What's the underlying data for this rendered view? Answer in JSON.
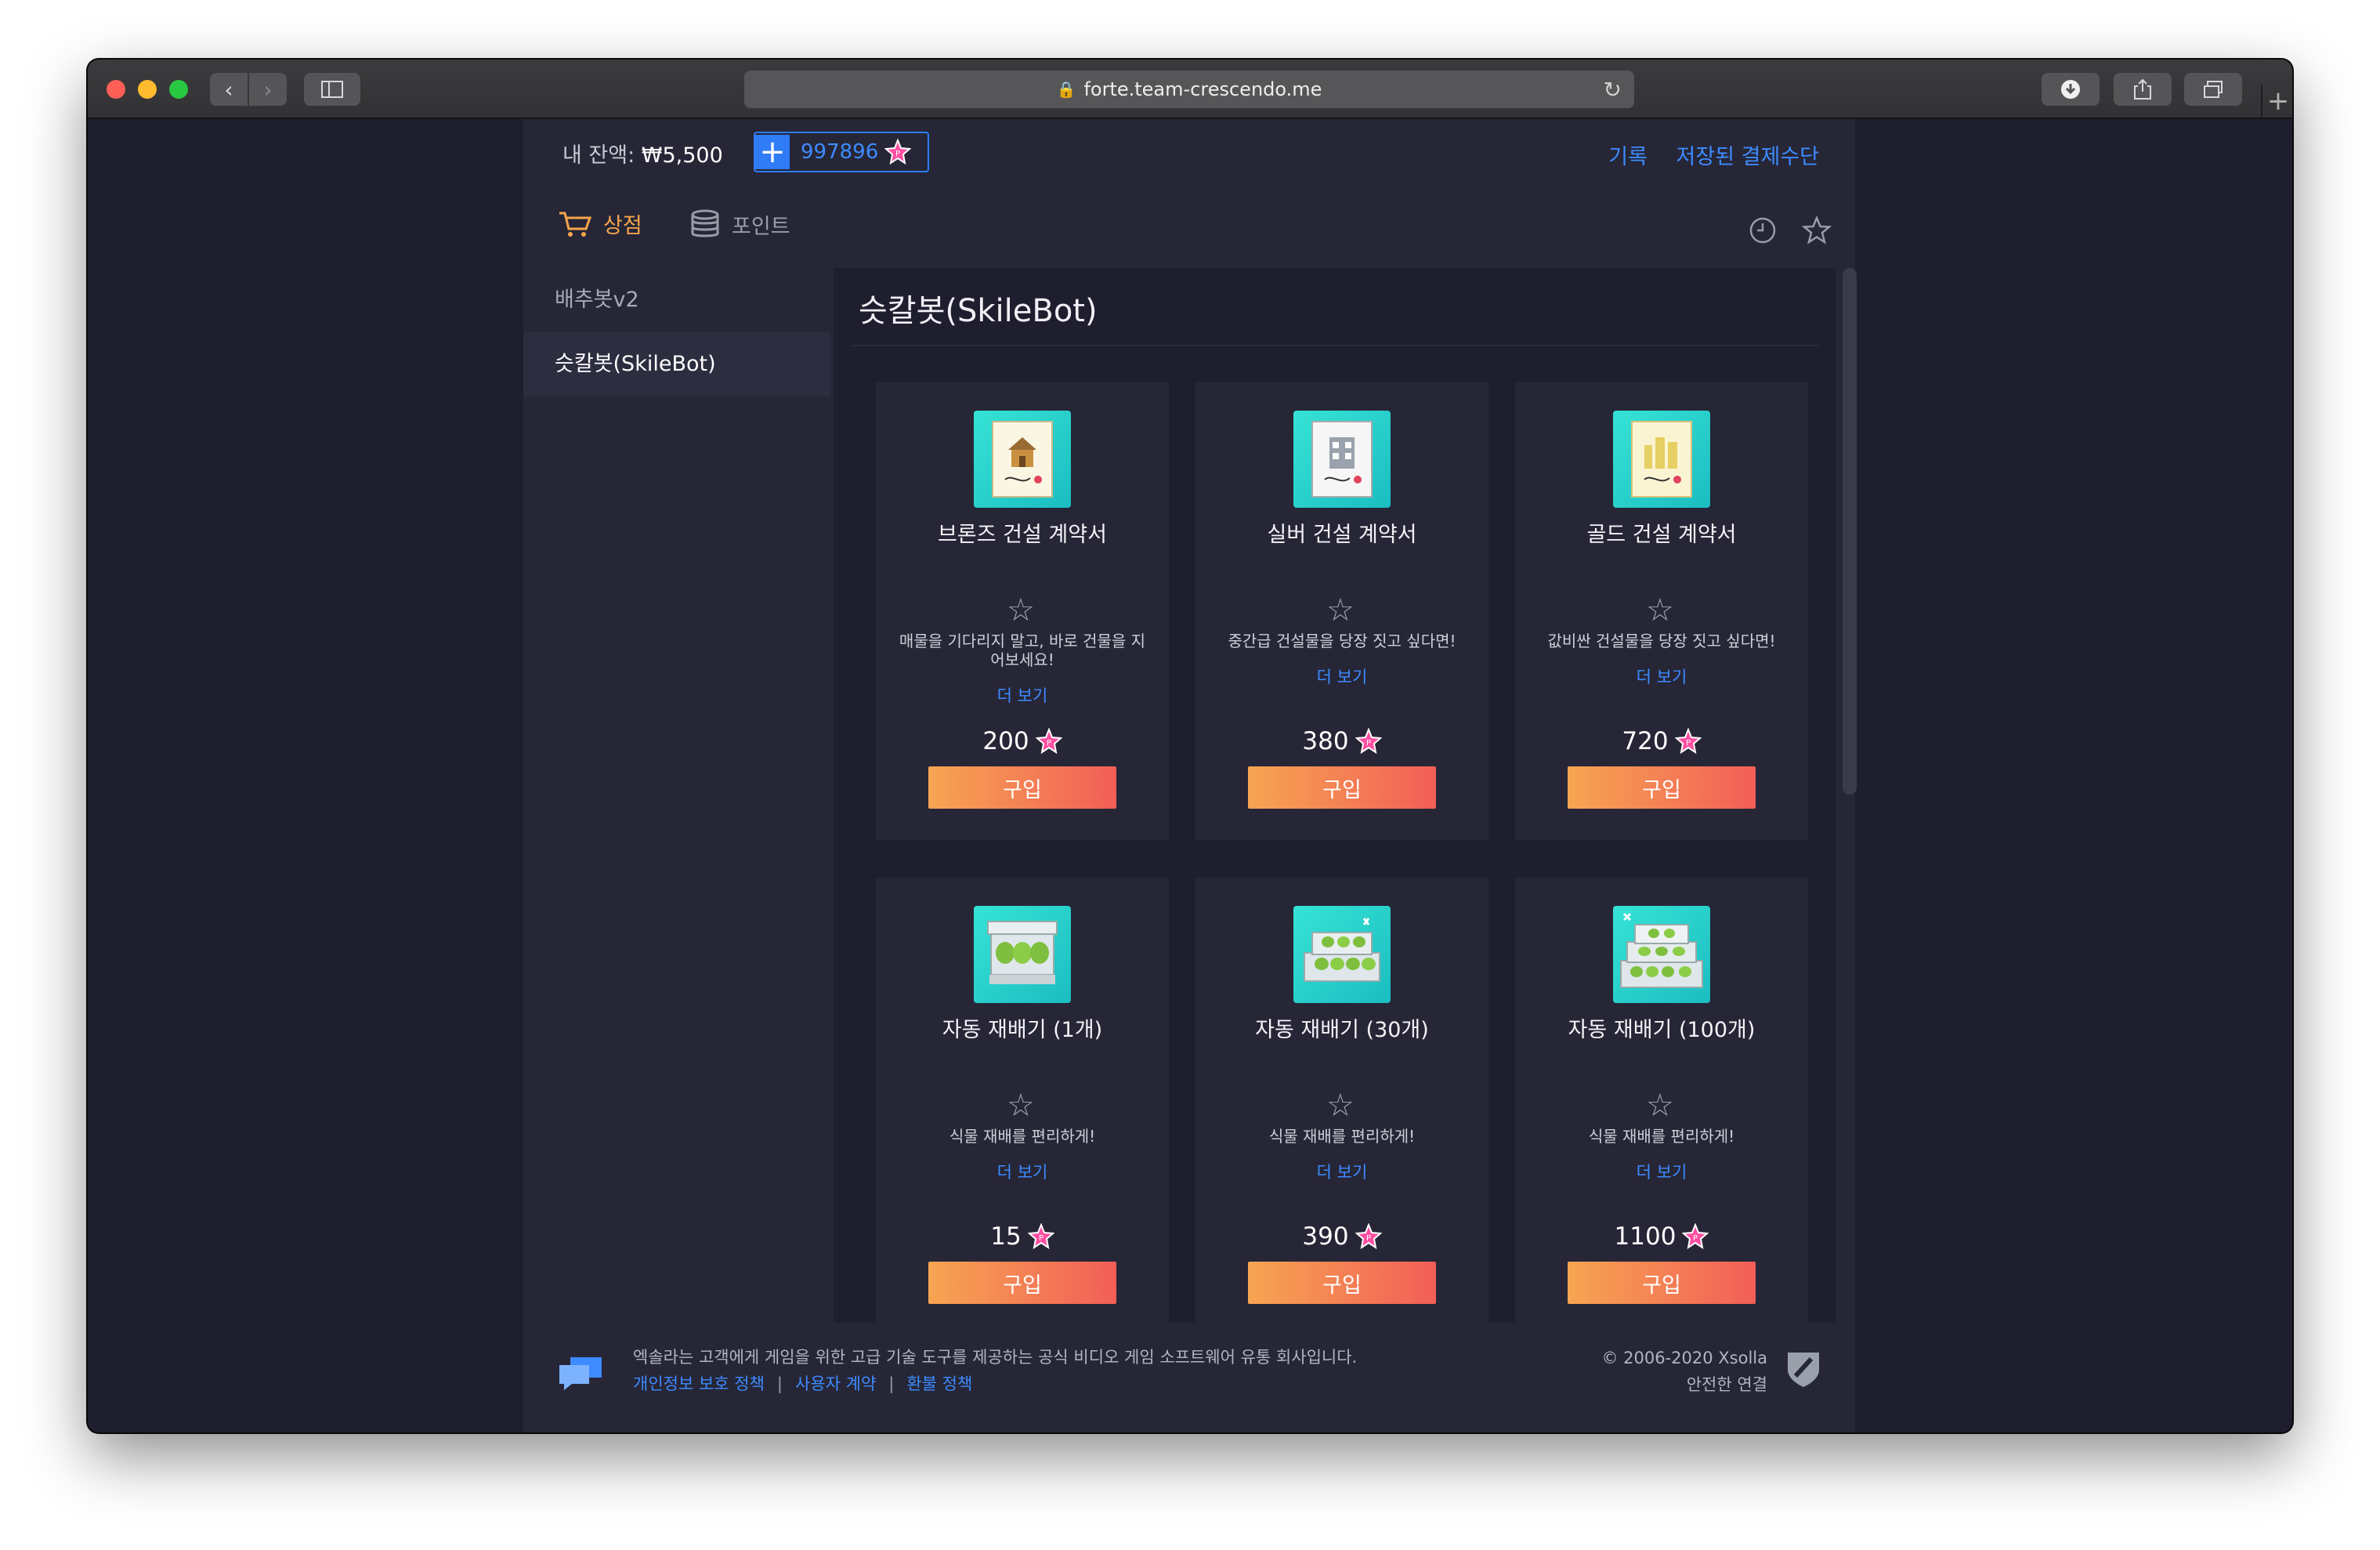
{
  "browser": {
    "url": "forte.team-crescendo.me"
  },
  "store": {
    "balance_label": "내 잔액:",
    "balance_value": "₩5,500",
    "points_value": "997896",
    "links": [
      "기록",
      "저장된 결제수단"
    ],
    "tabs": [
      {
        "label": "상점",
        "icon": "cart-icon",
        "active": true
      },
      {
        "label": "포인트",
        "icon": "coins-icon",
        "active": false
      }
    ],
    "sidebar": [
      {
        "label": "배추봇v2",
        "active": false
      },
      {
        "label": "슷칼봇(SkileBot)",
        "active": true
      }
    ],
    "section_title": "슷칼봇(SkileBot)",
    "items": [
      {
        "name": "브론즈 건설 계약서",
        "desc": "매물을 기다리지 말고, 바로 건물을 지어보세요!",
        "more": "더 보기",
        "price": "200",
        "buy": "구입",
        "icon": "contract-house-icon"
      },
      {
        "name": "실버 건설 계약서",
        "desc": "중간급 건설물을 당장 짓고 싶다면!",
        "more": "더 보기",
        "price": "380",
        "buy": "구입",
        "icon": "contract-building-icon"
      },
      {
        "name": "골드 건설 계약서",
        "desc": "값비싼 건설물을 당장 짓고 싶다면!",
        "more": "더 보기",
        "price": "720",
        "buy": "구입",
        "icon": "contract-city-icon"
      },
      {
        "name": "자동 재배기 (1개)",
        "desc": "식물 재배를 편리하게!",
        "more": "더 보기",
        "price": "15",
        "buy": "구입",
        "icon": "planter-icon"
      },
      {
        "name": "자동 재배기 (30개)",
        "desc": "식물 재배를 편리하게!",
        "more": "더 보기",
        "price": "390",
        "buy": "구입",
        "icon": "planter-stack-icon"
      },
      {
        "name": "자동 재배기 (100개)",
        "desc": "식물 재배를 편리하게!",
        "more": "더 보기",
        "price": "1100",
        "buy": "구입",
        "icon": "planter-pile-icon"
      }
    ],
    "footer": {
      "text": "엑솔라는 고객에게 게임을 위한 고급 기술 도구를 제공하는 공식 비디오 게임 소프트웨어 유통 회사입니다.",
      "links": [
        "개인정보 보호 정책",
        "사용자 계약",
        "환불 정책"
      ],
      "copyright": "© 2006-2020 Xsolla",
      "secure": "안전한 연결"
    }
  },
  "colors": {
    "accent": "#3d8bff",
    "shop_tab": "#f6a54b",
    "buy_gradient_start": "#f7a552",
    "buy_gradient_end": "#f25e57"
  }
}
